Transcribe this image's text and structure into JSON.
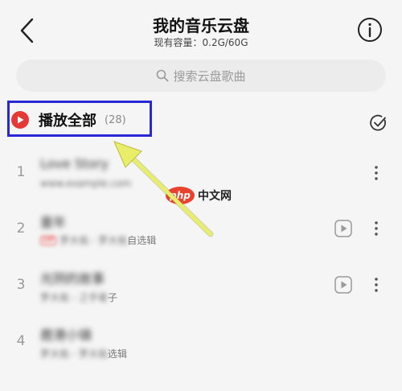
{
  "header": {
    "title": "我的音乐云盘",
    "capacity": "现有容量：0.2G/60G"
  },
  "search": {
    "placeholder": "搜索云盘歌曲"
  },
  "play_all": {
    "label": "播放全部",
    "count": "(28)"
  },
  "songs": [
    {
      "num": "1",
      "title": "Love Story",
      "subtitle": "www.example.com"
    },
    {
      "num": "2",
      "title": "童年",
      "subtitle_blur": "罗大佑 - 罗大佑",
      "subtitle_clear": "自选辑"
    },
    {
      "num": "3",
      "title": "光阴的故事",
      "subtitle_blur": "罗大佑 - 之乎者",
      "subtitle_clear": "子"
    },
    {
      "num": "4",
      "title": "鹿港小镇",
      "subtitle_blur": "罗大佑 - 罗大佑",
      "subtitle_clear": "选辑"
    }
  ],
  "watermark": {
    "logo": "php",
    "text": "中文网"
  },
  "colors": {
    "accent_red": "#e53935",
    "highlight_blue": "#2828d6",
    "arrow_yellow": "#e8ee6a"
  }
}
